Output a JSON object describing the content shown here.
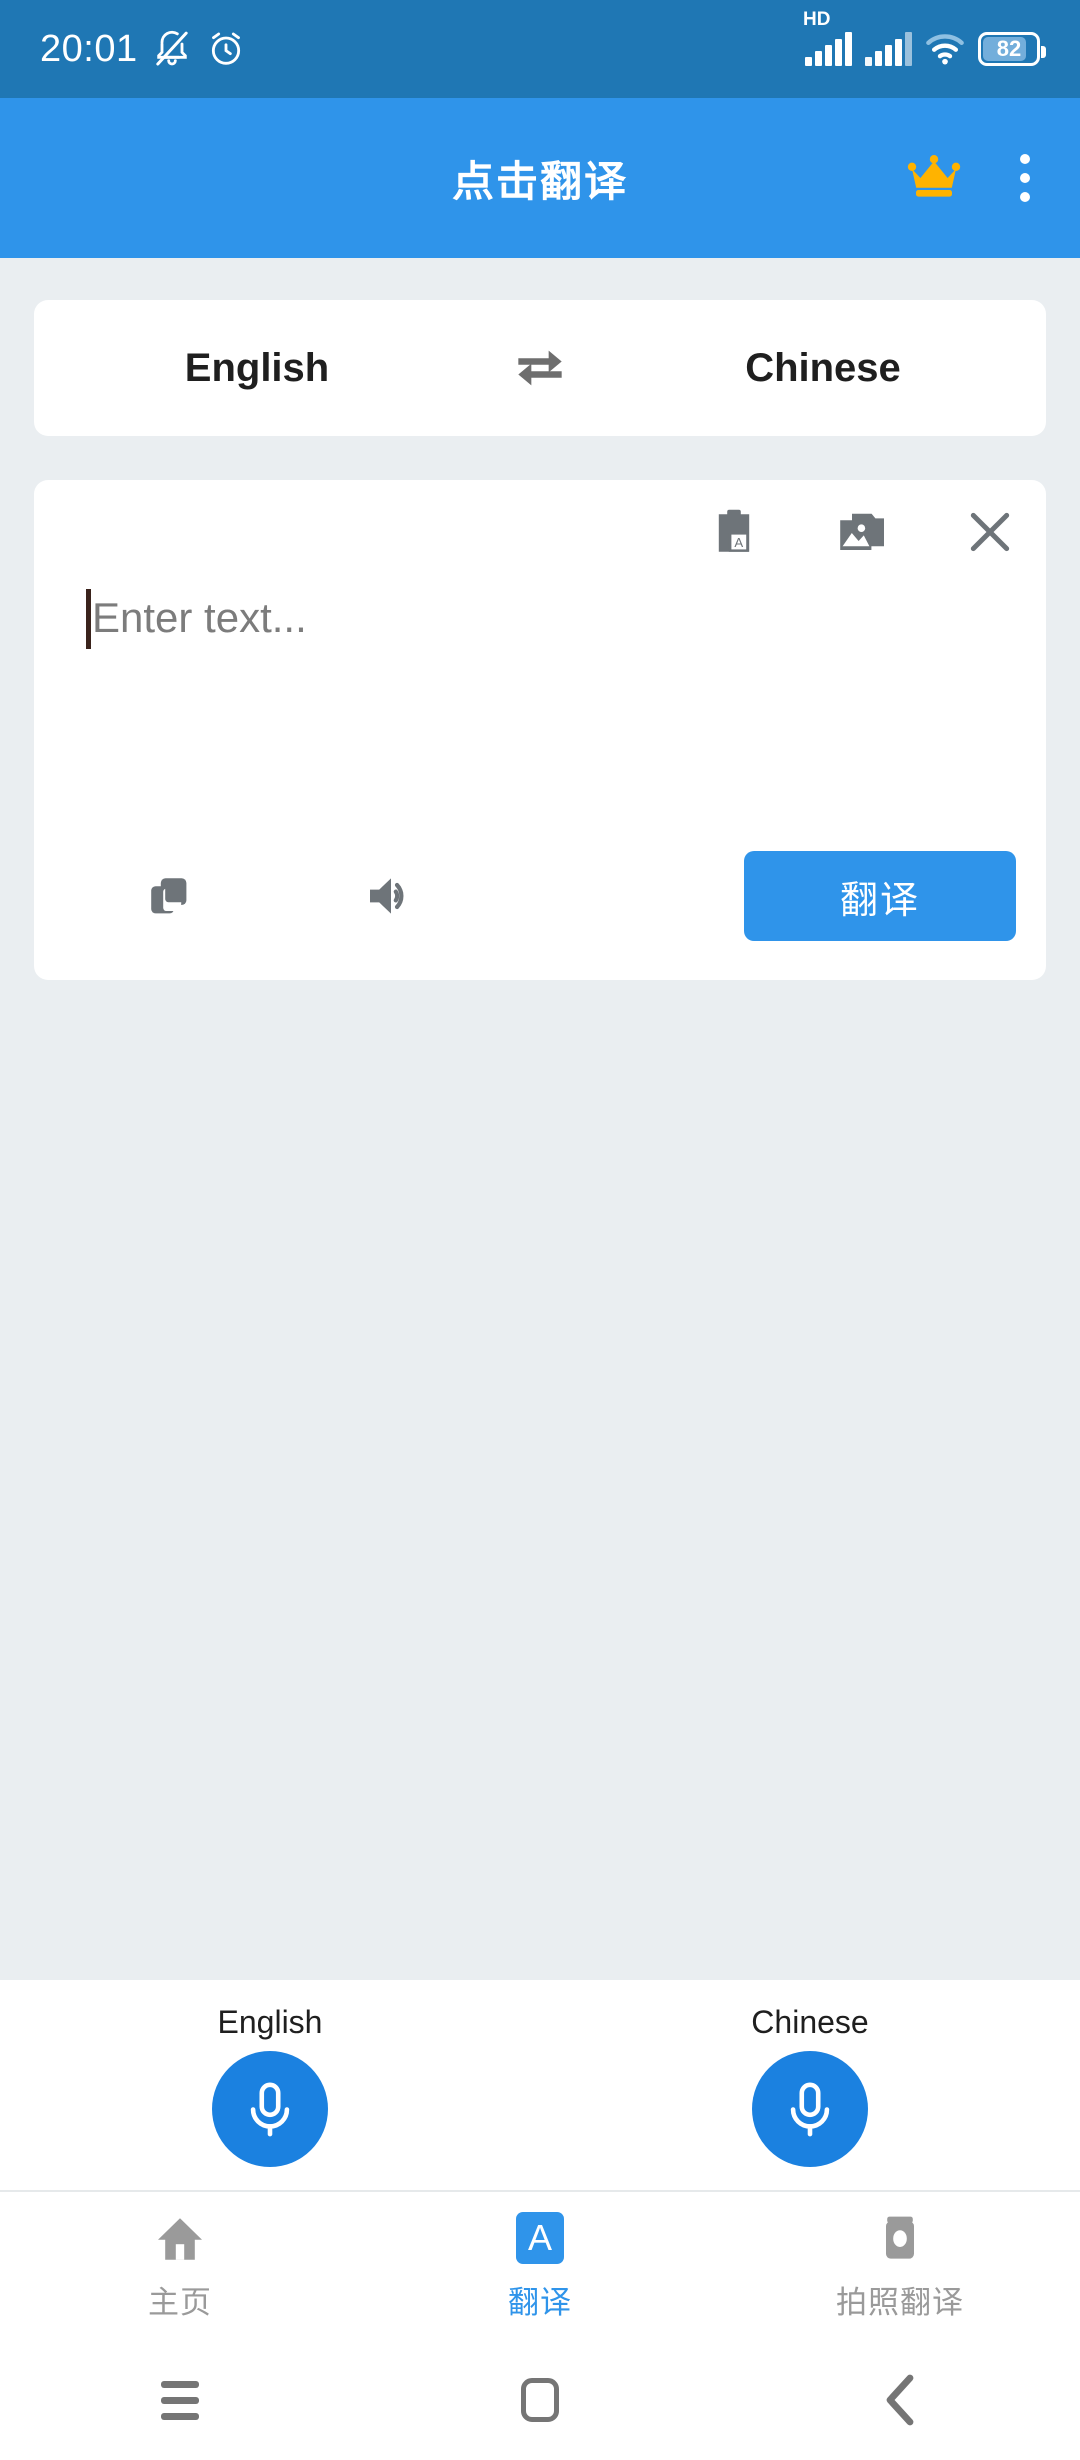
{
  "status_bar": {
    "time": "20:01",
    "icons": [
      "bell-mute-icon",
      "alarm-clock-icon",
      "hd-signal-icon",
      "signal-bars-icon",
      "wifi-icon",
      "battery-icon"
    ],
    "hd_label": "HD",
    "battery_percent": "82"
  },
  "app_bar": {
    "title": "点击翻译",
    "crown_label": "premium-crown",
    "crown_color": "#FFB300",
    "background": "#2F94EA",
    "overflow_label": "more-options"
  },
  "language_selector": {
    "source_language": "English",
    "target_language": "Chinese",
    "swap_label": "swap-languages"
  },
  "input_card": {
    "placeholder": "Enter text...",
    "value": "",
    "toolbar": {
      "paste_label": "paste-from-clipboard",
      "gallery_label": "pick-image",
      "clear_label": "clear-text"
    },
    "actions": {
      "copy_label": "copy-text",
      "speak_label": "speak-text",
      "translate_label": "翻译"
    }
  },
  "voice_panel": {
    "buttons": [
      {
        "label": "English",
        "icon": "microphone-icon"
      },
      {
        "label": "Chinese",
        "icon": "microphone-icon"
      }
    ]
  },
  "bottom_nav": {
    "active_index": 1,
    "items": [
      {
        "label": "主页",
        "icon": "home-icon"
      },
      {
        "label": "翻译",
        "icon": "translate-a-icon"
      },
      {
        "label": "拍照翻译",
        "icon": "camera-icon"
      }
    ],
    "accent_color": "#2F94EA",
    "inactive_color": "#9A9A9A"
  },
  "system_nav": {
    "recents_label": "recent-apps",
    "home_label": "home",
    "back_label": "back"
  }
}
